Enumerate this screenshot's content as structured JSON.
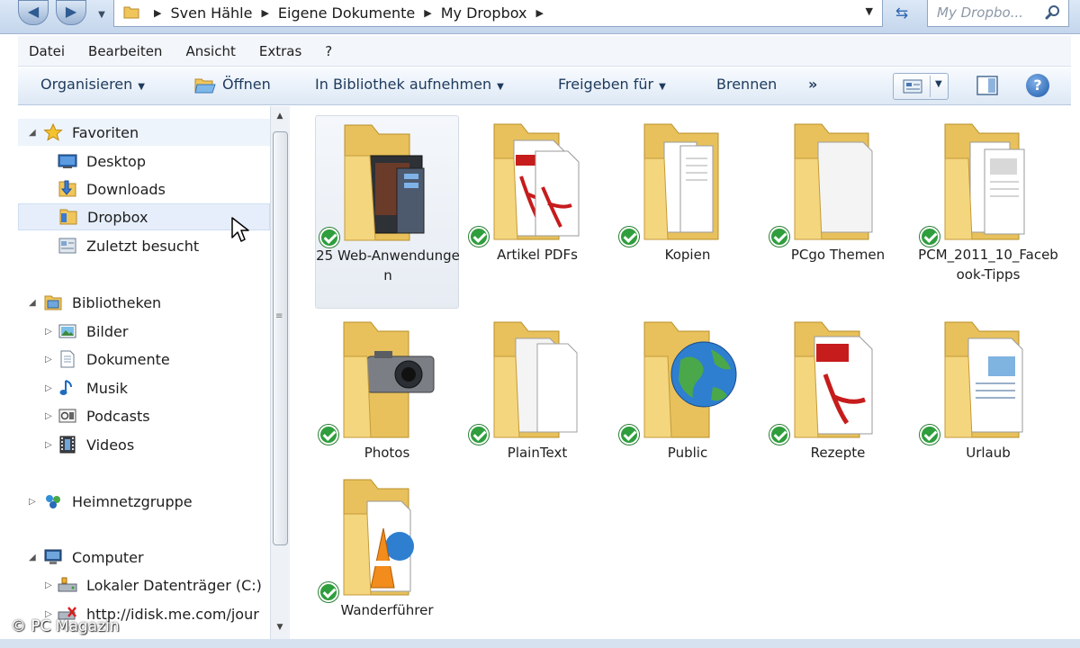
{
  "address": {
    "breadcrumbs": [
      "Sven Hähle",
      "Eigene Dokumente",
      "My Dropbox"
    ],
    "search_placeholder": "My Dropbo..."
  },
  "menu": [
    "Datei",
    "Bearbeiten",
    "Ansicht",
    "Extras",
    "?"
  ],
  "toolbar": {
    "organize": "Organisieren",
    "open": "Öffnen",
    "library": "In Bibliothek aufnehmen",
    "share": "Freigeben für",
    "burn": "Brennen",
    "more": "»"
  },
  "nav": {
    "favorites": "Favoriten",
    "desktop": "Desktop",
    "downloads": "Downloads",
    "dropbox": "Dropbox",
    "recent": "Zuletzt besucht",
    "libraries": "Bibliotheken",
    "pictures": "Bilder",
    "documents": "Dokumente",
    "music": "Musik",
    "podcasts": "Podcasts",
    "videos": "Videos",
    "homegroup": "Heimnetzgruppe",
    "computer": "Computer",
    "local_disk": "Lokaler Datenträger (C:)",
    "idisk": "http://idisk.me.com/jour"
  },
  "folders": [
    {
      "label": "25 Web-Anwendungen",
      "icon": "folder-screenshots-icon"
    },
    {
      "label": "Artikel PDFs",
      "icon": "folder-pdf-icon"
    },
    {
      "label": "Kopien",
      "icon": "folder-documents-icon"
    },
    {
      "label": "PCgo Themen",
      "icon": "folder-blank-pages-icon"
    },
    {
      "label": "PCM_2011_10_Facebook-Tipps",
      "icon": "folder-documents-icon"
    },
    {
      "label": "Photos",
      "icon": "folder-camera-icon"
    },
    {
      "label": "PlainText",
      "icon": "folder-pages-icon"
    },
    {
      "label": "Public",
      "icon": "folder-globe-icon"
    },
    {
      "label": "Rezepte",
      "icon": "folder-pdf-icon"
    },
    {
      "label": "Urlaub",
      "icon": "folder-word-icon"
    },
    {
      "label": "Wanderführer",
      "icon": "folder-vlc-icon"
    }
  ],
  "watermark": "© PC Magazin",
  "colors": {
    "sync_check": "#2f9e3d",
    "folder": "#f2d27a",
    "selection": "#e5eefa"
  }
}
